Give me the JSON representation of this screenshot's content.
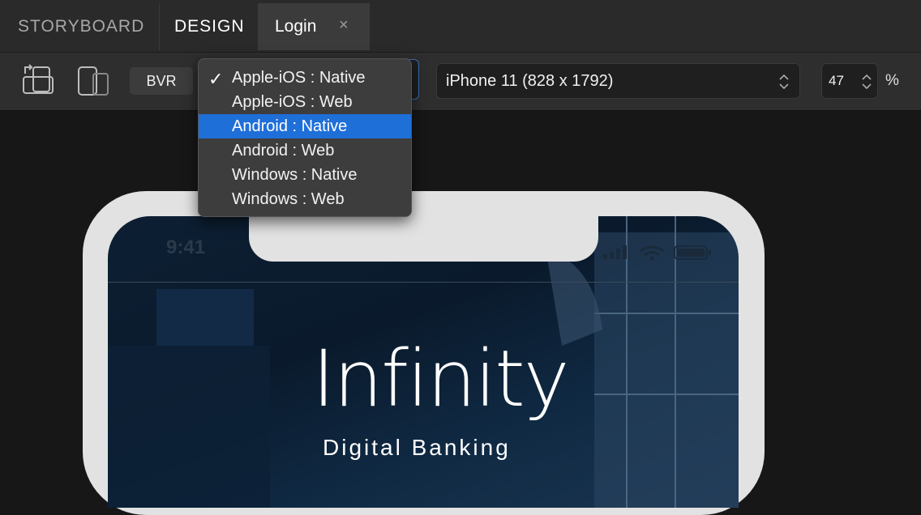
{
  "tabs": {
    "storyboard": "STORYBOARD",
    "design": "DESIGN",
    "login": "Login",
    "close_glyph": "×"
  },
  "toolbar": {
    "bvr_label": "BVR",
    "device_value": "iPhone 11 (828 x 1792)",
    "zoom_value": "47",
    "zoom_unit": "%",
    "rotate_icon": "rotate-device-icon",
    "device_preview_icon": "device-preview-icon"
  },
  "platform_menu": {
    "checked": "Apple-iOS : Native",
    "highlighted": "Android : Native",
    "items": [
      "Apple-iOS : Native",
      "Apple-iOS : Web",
      "Android : Native",
      "Android : Web",
      "Windows : Native",
      "Windows : Web"
    ]
  },
  "preview": {
    "status_time": "9:41",
    "brand": "Infinity",
    "tagline": "Digital Banking"
  },
  "colors": {
    "accent": "#1f6fd9",
    "background": "#171717",
    "toolbar": "#2e2e2e"
  }
}
